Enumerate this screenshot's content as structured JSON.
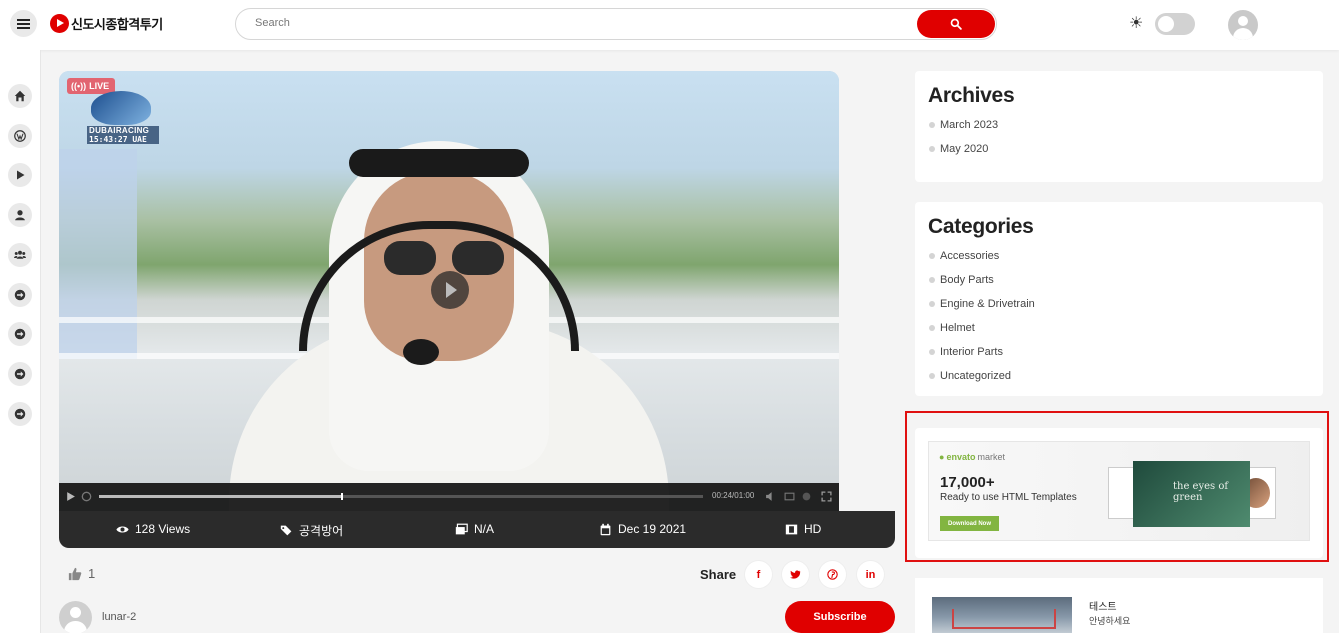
{
  "header": {
    "logo_text": "신도시종합격투기",
    "search_placeholder": "Search"
  },
  "rail": {
    "items": [
      "home-icon",
      "wordpress-icon",
      "play-icon",
      "user-icon",
      "users-icon",
      "arrow-right-icon",
      "arrow-right-icon",
      "arrow-right-icon",
      "arrow-right-icon"
    ]
  },
  "video": {
    "live_label": "LIVE",
    "channel_name": "DUBAIRACING",
    "channel_time": "15:43:27 UAE",
    "time_display": "00:24/01:00",
    "progress_fraction": 0.4
  },
  "meta": {
    "views": "128 Views",
    "tag": "공격방어",
    "category": "N/A",
    "date": "Dec 19 2021",
    "quality": "HD"
  },
  "engagement": {
    "like_count": "1",
    "share_label": "Share",
    "share_targets": [
      "f",
      "twitter",
      "p",
      "in"
    ]
  },
  "channel": {
    "name": "lunar-2",
    "subscribe_label": "Subscribe"
  },
  "sidebar": {
    "archives": {
      "title": "Archives",
      "items": [
        "March 2023",
        "May 2020"
      ]
    },
    "categories": {
      "title": "Categories",
      "items": [
        "Accessories",
        "Body Parts",
        "Engine & Drivetrain",
        "Helmet",
        "Interior Parts",
        "Uncategorized"
      ]
    },
    "ad": {
      "brand_prefix": "envato",
      "brand_suffix": "market",
      "headline": "17,000+",
      "subline": "Ready to use HTML Templates",
      "button": "Download Now",
      "hero_text": "the eyes of green"
    },
    "recommended": {
      "title": "테스트",
      "subtitle": "안녕하세요"
    }
  },
  "colors": {
    "accent": "#e00000",
    "highlight_frame": "#e01010",
    "envato_green": "#82b541"
  }
}
